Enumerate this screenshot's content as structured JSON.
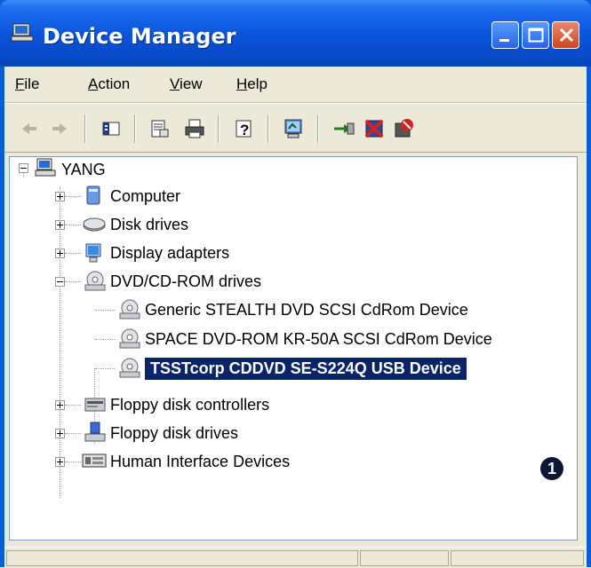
{
  "window": {
    "title": "Device Manager"
  },
  "menu": {
    "items": [
      {
        "label": "File",
        "accel": "F",
        "rest": "ile"
      },
      {
        "label": "Action",
        "accel": "A",
        "rest": "ction"
      },
      {
        "label": "View",
        "accel": "V",
        "rest": "iew"
      },
      {
        "label": "Help",
        "accel": "H",
        "rest": "elp"
      }
    ]
  },
  "tree": {
    "root": "YANG",
    "items": [
      {
        "label": "Computer",
        "icon": "computer-icon",
        "expanded": false
      },
      {
        "label": "Disk drives",
        "icon": "disk-drive-icon",
        "expanded": false
      },
      {
        "label": "Display adapters",
        "icon": "display-adapter-icon",
        "expanded": false
      },
      {
        "label": "DVD/CD-ROM drives",
        "icon": "cdrom-icon",
        "expanded": true,
        "children": [
          "Generic STEALTH DVD SCSI CdRom Device",
          "SPACE DVD-ROM KR-50A SCSI CdRom Device",
          "TSSTcorp CDDVD SE-S224Q USB Device"
        ]
      },
      {
        "label": "Floppy disk controllers",
        "icon": "floppy-controller-icon",
        "expanded": false
      },
      {
        "label": "Floppy disk drives",
        "icon": "floppy-drive-icon",
        "expanded": false
      },
      {
        "label": "Human Interface Devices",
        "icon": "hid-icon",
        "expanded": false
      }
    ],
    "selected": "TSSTcorp CDDVD SE-S224Q USB Device"
  },
  "callout": "1",
  "colors": {
    "titlebar": "#0a55dc",
    "selection": "#0a246a",
    "face": "#ece9d8"
  }
}
